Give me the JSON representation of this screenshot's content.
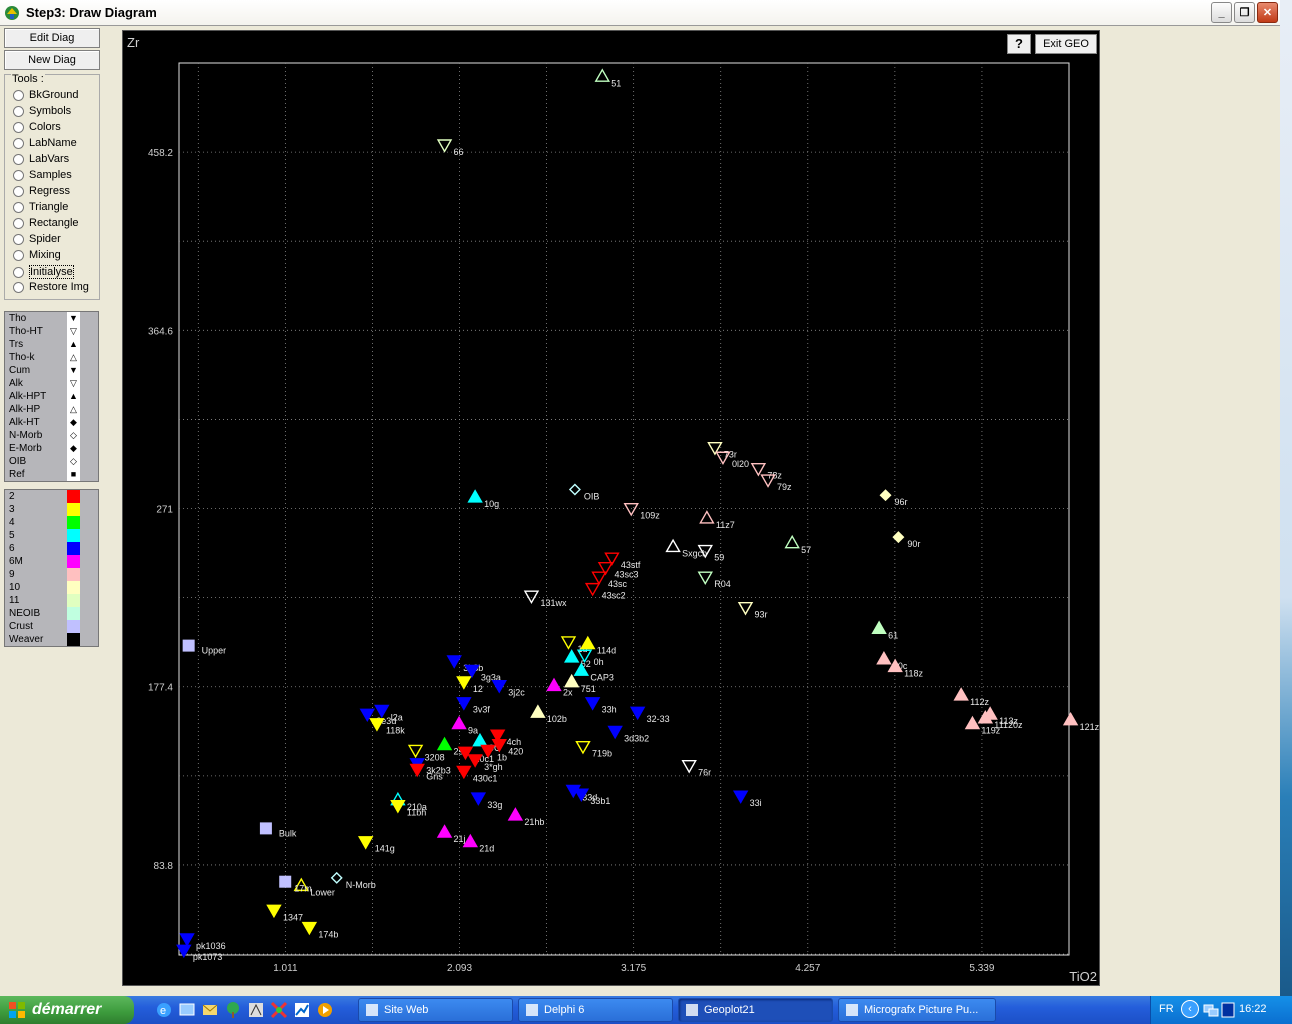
{
  "window": {
    "title": "Step3: Draw Diagram"
  },
  "left_buttons": {
    "edit": "Edit Diag",
    "new": "New Diag"
  },
  "tools": {
    "legend": "Tools :",
    "items": [
      "BkGround",
      "Symbols",
      "Colors",
      "LabName",
      "LabVars",
      "Samples",
      "Regress",
      "Triangle",
      "Rectangle",
      "Spider",
      "Mixing",
      "Initialyse",
      "Restore Img"
    ]
  },
  "symbol_list": [
    {
      "label": "Tho",
      "glyph": "▼"
    },
    {
      "label": "Tho-HT",
      "glyph": "▽"
    },
    {
      "label": "Trs",
      "glyph": "▲"
    },
    {
      "label": "Tho-k",
      "glyph": "△"
    },
    {
      "label": "Cum",
      "glyph": "▼"
    },
    {
      "label": "Alk",
      "glyph": "▽"
    },
    {
      "label": "Alk-HPT",
      "glyph": "▲"
    },
    {
      "label": "Alk-HP",
      "glyph": "△"
    },
    {
      "label": "Alk-HT",
      "glyph": "◆"
    },
    {
      "label": "N-Morb",
      "glyph": "◇"
    },
    {
      "label": "E-Morb",
      "glyph": "◆"
    },
    {
      "label": "OIB",
      "glyph": "◇"
    },
    {
      "label": "Ref",
      "glyph": "■"
    }
  ],
  "color_list": [
    {
      "label": "2",
      "color": "#ff0000"
    },
    {
      "label": "3",
      "color": "#ffff00"
    },
    {
      "label": "4",
      "color": "#00ff00"
    },
    {
      "label": "5",
      "color": "#00ffff"
    },
    {
      "label": "6",
      "color": "#0000ff"
    },
    {
      "label": "6M",
      "color": "#ff00ff"
    },
    {
      "label": "9",
      "color": "#ffc0c0"
    },
    {
      "label": "10",
      "color": "#ffffc0"
    },
    {
      "label": "11",
      "color": "#e0ffc0"
    },
    {
      "label": "NEOIB",
      "color": "#c0ffe0"
    },
    {
      "label": "Crust",
      "color": "#c0c0ff"
    },
    {
      "label": "Weaver",
      "color": "#000000"
    }
  ],
  "plot_buttons": {
    "help": "?",
    "exit": "Exit GEO"
  },
  "chart_data": {
    "type": "scatter",
    "xlabel": "TiO2",
    "ylabel": "Zr",
    "xticks": [
      "1.011",
      "2.093",
      "3.175",
      "4.257",
      "5.339"
    ],
    "yticks": [
      "83.8",
      "177.4",
      "271",
      "364.6",
      "458.2"
    ],
    "xlim": [
      0.35,
      5.88
    ],
    "ylim": [
      36.5,
      505
    ],
    "grid": true,
    "points": [
      {
        "x": 2.98,
        "y": 498,
        "label": "51",
        "shape": "tri-up",
        "fill": false,
        "color": "#c0ffc0"
      },
      {
        "x": 2.0,
        "y": 462,
        "label": "66",
        "shape": "tri-down",
        "fill": false,
        "color": "#e0ffc0"
      },
      {
        "x": 3.68,
        "y": 303,
        "label": "73r",
        "shape": "tri-down",
        "fill": false,
        "color": "#ffffc0"
      },
      {
        "x": 3.73,
        "y": 298,
        "label": "0l20",
        "shape": "tri-down",
        "fill": false,
        "color": "#ffc0c0"
      },
      {
        "x": 3.95,
        "y": 292,
        "label": "78z",
        "shape": "tri-down",
        "fill": false,
        "color": "#ffc0c0"
      },
      {
        "x": 4.01,
        "y": 286,
        "label": "79z",
        "shape": "tri-down",
        "fill": false,
        "color": "#ffc0c0"
      },
      {
        "x": 4.74,
        "y": 278,
        "label": "96r",
        "shape": "diamond",
        "fill": true,
        "color": "#ffffc0"
      },
      {
        "x": 4.82,
        "y": 256,
        "label": "90r",
        "shape": "diamond",
        "fill": true,
        "color": "#ffffc0"
      },
      {
        "x": 2.19,
        "y": 277,
        "label": "10g",
        "shape": "tri-up",
        "fill": true,
        "color": "#00ffff"
      },
      {
        "x": 2.81,
        "y": 281,
        "label": "OIB",
        "shape": "diamond",
        "fill": false,
        "color": "#c0ffff"
      },
      {
        "x": 3.16,
        "y": 271,
        "label": "109z",
        "shape": "tri-down",
        "fill": false,
        "color": "#ffc0c0"
      },
      {
        "x": 3.63,
        "y": 266,
        "label": "11z7",
        "shape": "tri-up",
        "fill": false,
        "color": "#ffc0c0"
      },
      {
        "x": 3.42,
        "y": 251,
        "label": "Sxgch",
        "shape": "tri-up",
        "fill": false,
        "color": "#ffffff"
      },
      {
        "x": 3.62,
        "y": 249,
        "label": "59",
        "shape": "tri-down",
        "fill": false,
        "color": "#ffffff"
      },
      {
        "x": 4.16,
        "y": 253,
        "label": "57",
        "shape": "tri-up",
        "fill": false,
        "color": "#c0ffc0"
      },
      {
        "x": 3.04,
        "y": 245,
        "label": "43stf",
        "shape": "tri-down",
        "fill": false,
        "color": "#ff0000"
      },
      {
        "x": 3.0,
        "y": 240,
        "label": "43sc3",
        "shape": "tri-down",
        "fill": false,
        "color": "#ff0000"
      },
      {
        "x": 2.96,
        "y": 235,
        "label": "43sc",
        "shape": "tri-down",
        "fill": false,
        "color": "#ff0000"
      },
      {
        "x": 2.92,
        "y": 229,
        "label": "43sc2",
        "shape": "tri-down",
        "fill": false,
        "color": "#ff0000"
      },
      {
        "x": 3.62,
        "y": 235,
        "label": "R04",
        "shape": "tri-down",
        "fill": false,
        "color": "#c0ffc0"
      },
      {
        "x": 2.54,
        "y": 225,
        "label": "131wx",
        "shape": "tri-down",
        "fill": false,
        "color": "#ffffff"
      },
      {
        "x": 3.87,
        "y": 219,
        "label": "93r",
        "shape": "tri-down",
        "fill": false,
        "color": "#ffffc0"
      },
      {
        "x": 4.7,
        "y": 208,
        "label": "61",
        "shape": "tri-up",
        "fill": true,
        "color": "#c0ffc0"
      },
      {
        "x": 4.73,
        "y": 192,
        "label": "10c",
        "shape": "tri-up",
        "fill": true,
        "color": "#ffc0c0"
      },
      {
        "x": 4.8,
        "y": 188,
        "label": "118z",
        "shape": "tri-up",
        "fill": true,
        "color": "#ffc0c0"
      },
      {
        "x": 5.21,
        "y": 173,
        "label": "112z",
        "shape": "tri-up",
        "fill": true,
        "color": "#ffc0c0"
      },
      {
        "x": 5.28,
        "y": 158,
        "label": "119z",
        "shape": "tri-up",
        "fill": true,
        "color": "#ffc0c0"
      },
      {
        "x": 5.39,
        "y": 163,
        "label": "113z",
        "shape": "tri-up",
        "fill": true,
        "color": "#ffc0c0"
      },
      {
        "x": 5.36,
        "y": 161,
        "label": "11120z",
        "shape": "tri-up",
        "fill": true,
        "color": "#ffc0c0"
      },
      {
        "x": 5.89,
        "y": 160,
        "label": "121z",
        "shape": "tri-up",
        "fill": true,
        "color": "#ffc0c0"
      },
      {
        "x": 2.77,
        "y": 201,
        "label": "1d",
        "shape": "tri-down",
        "fill": false,
        "color": "#ffff00"
      },
      {
        "x": 2.89,
        "y": 200,
        "label": "114d",
        "shape": "tri-up",
        "fill": true,
        "color": "#ffff00"
      },
      {
        "x": 2.79,
        "y": 193,
        "label": "52",
        "shape": "tri-up",
        "fill": true,
        "color": "#00ffff"
      },
      {
        "x": 2.87,
        "y": 194,
        "label": "0h",
        "shape": "tri-down",
        "fill": false,
        "color": "#00ffff"
      },
      {
        "x": 2.85,
        "y": 186,
        "label": "CAP3",
        "shape": "tri-up",
        "fill": true,
        "color": "#00ffff"
      },
      {
        "x": 2.79,
        "y": 180,
        "label": "751",
        "shape": "tri-up",
        "fill": true,
        "color": "#ffffc0"
      },
      {
        "x": 2.68,
        "y": 178,
        "label": "2x",
        "shape": "tri-up",
        "fill": true,
        "color": "#ff00ff"
      },
      {
        "x": 2.06,
        "y": 191,
        "label": "3h3b",
        "shape": "tri-down",
        "fill": true,
        "color": "#0000ff"
      },
      {
        "x": 2.17,
        "y": 186,
        "label": "3g3a",
        "shape": "tri-down",
        "fill": true,
        "color": "#0000ff"
      },
      {
        "x": 2.12,
        "y": 180,
        "label": "12",
        "shape": "tri-down",
        "fill": true,
        "color": "#ffff00"
      },
      {
        "x": 2.34,
        "y": 178,
        "label": "3j2c",
        "shape": "tri-down",
        "fill": true,
        "color": "#0000ff"
      },
      {
        "x": 2.12,
        "y": 169,
        "label": "3v3f",
        "shape": "tri-down",
        "fill": true,
        "color": "#0000ff"
      },
      {
        "x": 2.92,
        "y": 169,
        "label": "33h",
        "shape": "tri-down",
        "fill": true,
        "color": "#0000ff"
      },
      {
        "x": 2.58,
        "y": 164,
        "label": "102b",
        "shape": "tri-up",
        "fill": true,
        "color": "#ffffc0"
      },
      {
        "x": 3.2,
        "y": 164,
        "label": "32-33",
        "shape": "tri-down",
        "fill": true,
        "color": "#0000ff"
      },
      {
        "x": 1.52,
        "y": 163,
        "label": "3e3d",
        "shape": "tri-down",
        "fill": true,
        "color": "#0000ff"
      },
      {
        "x": 1.61,
        "y": 165,
        "label": "l2a",
        "shape": "tri-down",
        "fill": true,
        "color": "#0000ff"
      },
      {
        "x": 1.58,
        "y": 158,
        "label": "118k",
        "shape": "tri-down",
        "fill": true,
        "color": "#ffff00"
      },
      {
        "x": 2.09,
        "y": 158,
        "label": "9a",
        "shape": "tri-up",
        "fill": true,
        "color": "#ff00ff"
      },
      {
        "x": 3.06,
        "y": 154,
        "label": "3d3b2",
        "shape": "tri-down",
        "fill": true,
        "color": "#0000ff"
      },
      {
        "x": 2.33,
        "y": 152,
        "label": "4ch",
        "shape": "tri-down",
        "fill": true,
        "color": "#ff0000"
      },
      {
        "x": 2.22,
        "y": 149,
        "label": "9C",
        "shape": "tri-up",
        "fill": true,
        "color": "#00ffff"
      },
      {
        "x": 2.34,
        "y": 147,
        "label": "420",
        "shape": "tri-down",
        "fill": true,
        "color": "#ff0000"
      },
      {
        "x": 2.0,
        "y": 147,
        "label": "2s",
        "shape": "tri-up",
        "fill": true,
        "color": "#00ff00"
      },
      {
        "x": 2.86,
        "y": 146,
        "label": "719b",
        "shape": "tri-down",
        "fill": false,
        "color": "#ffff00"
      },
      {
        "x": 2.27,
        "y": 144,
        "label": "1b",
        "shape": "tri-down",
        "fill": true,
        "color": "#ff0000"
      },
      {
        "x": 2.13,
        "y": 143,
        "label": "20c1",
        "shape": "tri-down",
        "fill": true,
        "color": "#ff0000"
      },
      {
        "x": 1.82,
        "y": 144,
        "label": "3208",
        "shape": "tri-down",
        "fill": false,
        "color": "#ffff00"
      },
      {
        "x": 2.19,
        "y": 139,
        "label": "3*gh",
        "shape": "tri-down",
        "fill": true,
        "color": "#ff0000"
      },
      {
        "x": 1.83,
        "y": 137,
        "label": "3k2b3",
        "shape": "tri-down",
        "fill": true,
        "color": "#0000ff"
      },
      {
        "x": 1.83,
        "y": 134,
        "label": "Gns",
        "shape": "tri-down",
        "fill": true,
        "color": "#ff0000"
      },
      {
        "x": 2.12,
        "y": 133,
        "label": "430c1",
        "shape": "tri-down",
        "fill": true,
        "color": "#ff0000"
      },
      {
        "x": 3.52,
        "y": 136,
        "label": "76r",
        "shape": "tri-down",
        "fill": false,
        "color": "#ffffff"
      },
      {
        "x": 2.8,
        "y": 123,
        "label": "33d",
        "shape": "tri-down",
        "fill": true,
        "color": "#0000ff"
      },
      {
        "x": 2.85,
        "y": 121,
        "label": "33b1",
        "shape": "tri-down",
        "fill": true,
        "color": "#0000ff"
      },
      {
        "x": 2.21,
        "y": 119,
        "label": "33g",
        "shape": "tri-down",
        "fill": true,
        "color": "#0000ff"
      },
      {
        "x": 3.84,
        "y": 120,
        "label": "33i",
        "shape": "tri-down",
        "fill": true,
        "color": "#0000ff"
      },
      {
        "x": 1.71,
        "y": 118,
        "label": "210a",
        "shape": "tri-up",
        "fill": false,
        "color": "#00ffff"
      },
      {
        "x": 1.71,
        "y": 115,
        "label": "11bh",
        "shape": "tri-down",
        "fill": true,
        "color": "#ffff00"
      },
      {
        "x": 2.44,
        "y": 110,
        "label": "21hb",
        "shape": "tri-up",
        "fill": true,
        "color": "#ff00ff"
      },
      {
        "x": 2.0,
        "y": 101,
        "label": "21j",
        "shape": "tri-up",
        "fill": true,
        "color": "#ff00ff"
      },
      {
        "x": 2.16,
        "y": 96,
        "label": "21d",
        "shape": "tri-up",
        "fill": true,
        "color": "#ff00ff"
      },
      {
        "x": 1.51,
        "y": 96,
        "label": "141g",
        "shape": "tri-down",
        "fill": true,
        "color": "#ffff00"
      },
      {
        "x": 0.94,
        "y": 60,
        "label": "1347",
        "shape": "tri-down",
        "fill": true,
        "color": "#ffff00"
      },
      {
        "x": 1.16,
        "y": 51,
        "label": "174b",
        "shape": "tri-down",
        "fill": true,
        "color": "#ffff00"
      },
      {
        "x": 1.11,
        "y": 73,
        "label": "Lower",
        "shape": "tri-up",
        "fill": false,
        "color": "#ffff00"
      },
      {
        "x": 1.01,
        "y": 75,
        "label": "17m",
        "shape": "square",
        "fill": true,
        "color": "#c0c0ff"
      },
      {
        "x": 1.33,
        "y": 77,
        "label": "N-Morb",
        "shape": "diamond",
        "fill": false,
        "color": "#c0ffff"
      },
      {
        "x": 0.4,
        "y": 45,
        "label": "pk1036",
        "shape": "tri-down",
        "fill": true,
        "color": "#0000ff"
      },
      {
        "x": 0.38,
        "y": 39,
        "label": "pk1073",
        "shape": "tri-down",
        "fill": true,
        "color": "#0000ff"
      }
    ],
    "ref_points": [
      {
        "x": 0.41,
        "y": 199,
        "label": "Upper",
        "color": "#c0c0ff"
      },
      {
        "x": 0.89,
        "y": 103,
        "label": "Bulk",
        "color": "#c0c0ff"
      }
    ]
  },
  "taskbar": {
    "start_label": "démarrer",
    "tasks": [
      "Site Web",
      "Delphi 6",
      "Geoplot21",
      "Micrografx Picture Pu..."
    ],
    "lang": "FR",
    "clock": "16:22"
  }
}
